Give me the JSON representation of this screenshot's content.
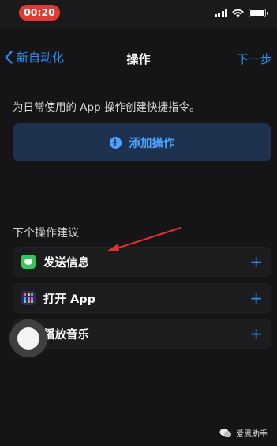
{
  "status_bar": {
    "time": "00:20",
    "time_pill_color": "#e03a36",
    "icons": [
      "signal-icon",
      "wifi-icon",
      "battery-icon"
    ]
  },
  "nav": {
    "back_label": "新自动化",
    "title": "操作",
    "next_label": "下一步",
    "accent_color": "#2b8ff6"
  },
  "main": {
    "intro_text": "为日常使用的 App 操作创建快捷指令。",
    "add_action_label": "添加操作"
  },
  "suggestions": {
    "section_title": "下个操作建议",
    "items": [
      {
        "label": "发送信息",
        "icon": "messages-icon"
      },
      {
        "label": "打开 App",
        "icon": "app-grid-icon"
      },
      {
        "label": "播放音乐",
        "icon": "music-icon"
      }
    ]
  },
  "annotation": {
    "arrow_color": "#e0312a"
  },
  "watermark": {
    "text": "爱思助手"
  }
}
